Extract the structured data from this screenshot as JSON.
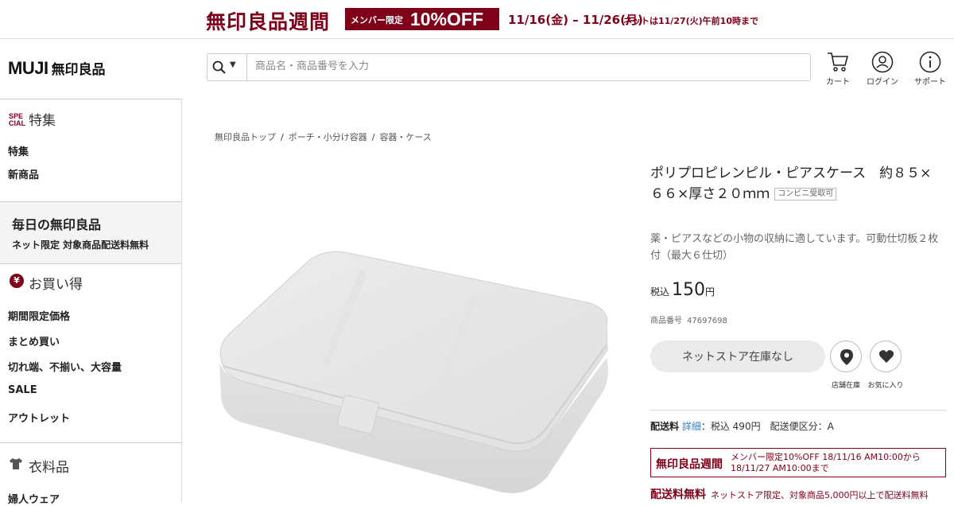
{
  "banner": {
    "title": "無印良品週間",
    "badge_small": "メンバー限定",
    "badge_big": "10%OFF",
    "dates": "11/16(金) – 11/26(月)",
    "note": "ネットは11/27(火)午前10時まで"
  },
  "header": {
    "logo_brand": "MUJI",
    "logo_jp": "無印良品",
    "search_placeholder": "商品名・商品番号を入力",
    "cart_label": "カート",
    "login_label": "ログイン",
    "support_label": "サポート"
  },
  "sidebar": {
    "special": {
      "icon_text_1": "SPE",
      "icon_text_2": "CIAL",
      "heading": "特集",
      "items": [
        "特集",
        "新商品"
      ]
    },
    "daily": {
      "title": "毎日の無印良品",
      "subtitle": "ネット限定 対象商品配送料無料"
    },
    "deals": {
      "icon_text": "¥",
      "heading": "お買い得",
      "items": [
        "期間限定価格",
        "まとめ買い",
        "切れ端、不揃い、大容量",
        "SALE",
        "アウトレット"
      ]
    },
    "clothing": {
      "heading": "衣料品",
      "items": [
        "婦人ウェア"
      ]
    }
  },
  "breadcrumb": [
    "無印良品トップ",
    "ポーチ・小分け容器",
    "容器・ケース"
  ],
  "product": {
    "title": "ポリプロピレンピル・ピアスケース　約８５×６６×厚さ２０ｍｍ",
    "convenience_tag": "コンビニ受取可",
    "description": "薬・ピアスなどの小物の収納に適しています。可動仕切板２枚付（最大６仕切）",
    "price_tax_label": "税込",
    "price": "150",
    "price_unit": "円",
    "sku_label": "商品番号",
    "sku": "47697698",
    "stock_button": "ネットストア在庫なし",
    "store_stock_label": "店舗在庫",
    "favorite_label": "お気に入り"
  },
  "shipping": {
    "label": "配送料",
    "detail_link": "詳細",
    "text": "：税込 490円　配送便区分：A"
  },
  "promo": {
    "title": "無印良品週間",
    "text": "メンバー限定10%OFF 18/11/16 AM10:00から 18/11/27 AM10:00まで"
  },
  "free_shipping": {
    "title": "配送料無料",
    "text": "ネットストア限定、対象商品5,000円以上で配送料無料"
  },
  "colors": {
    "brand": "#7f0019",
    "link": "#3a7cc0"
  }
}
